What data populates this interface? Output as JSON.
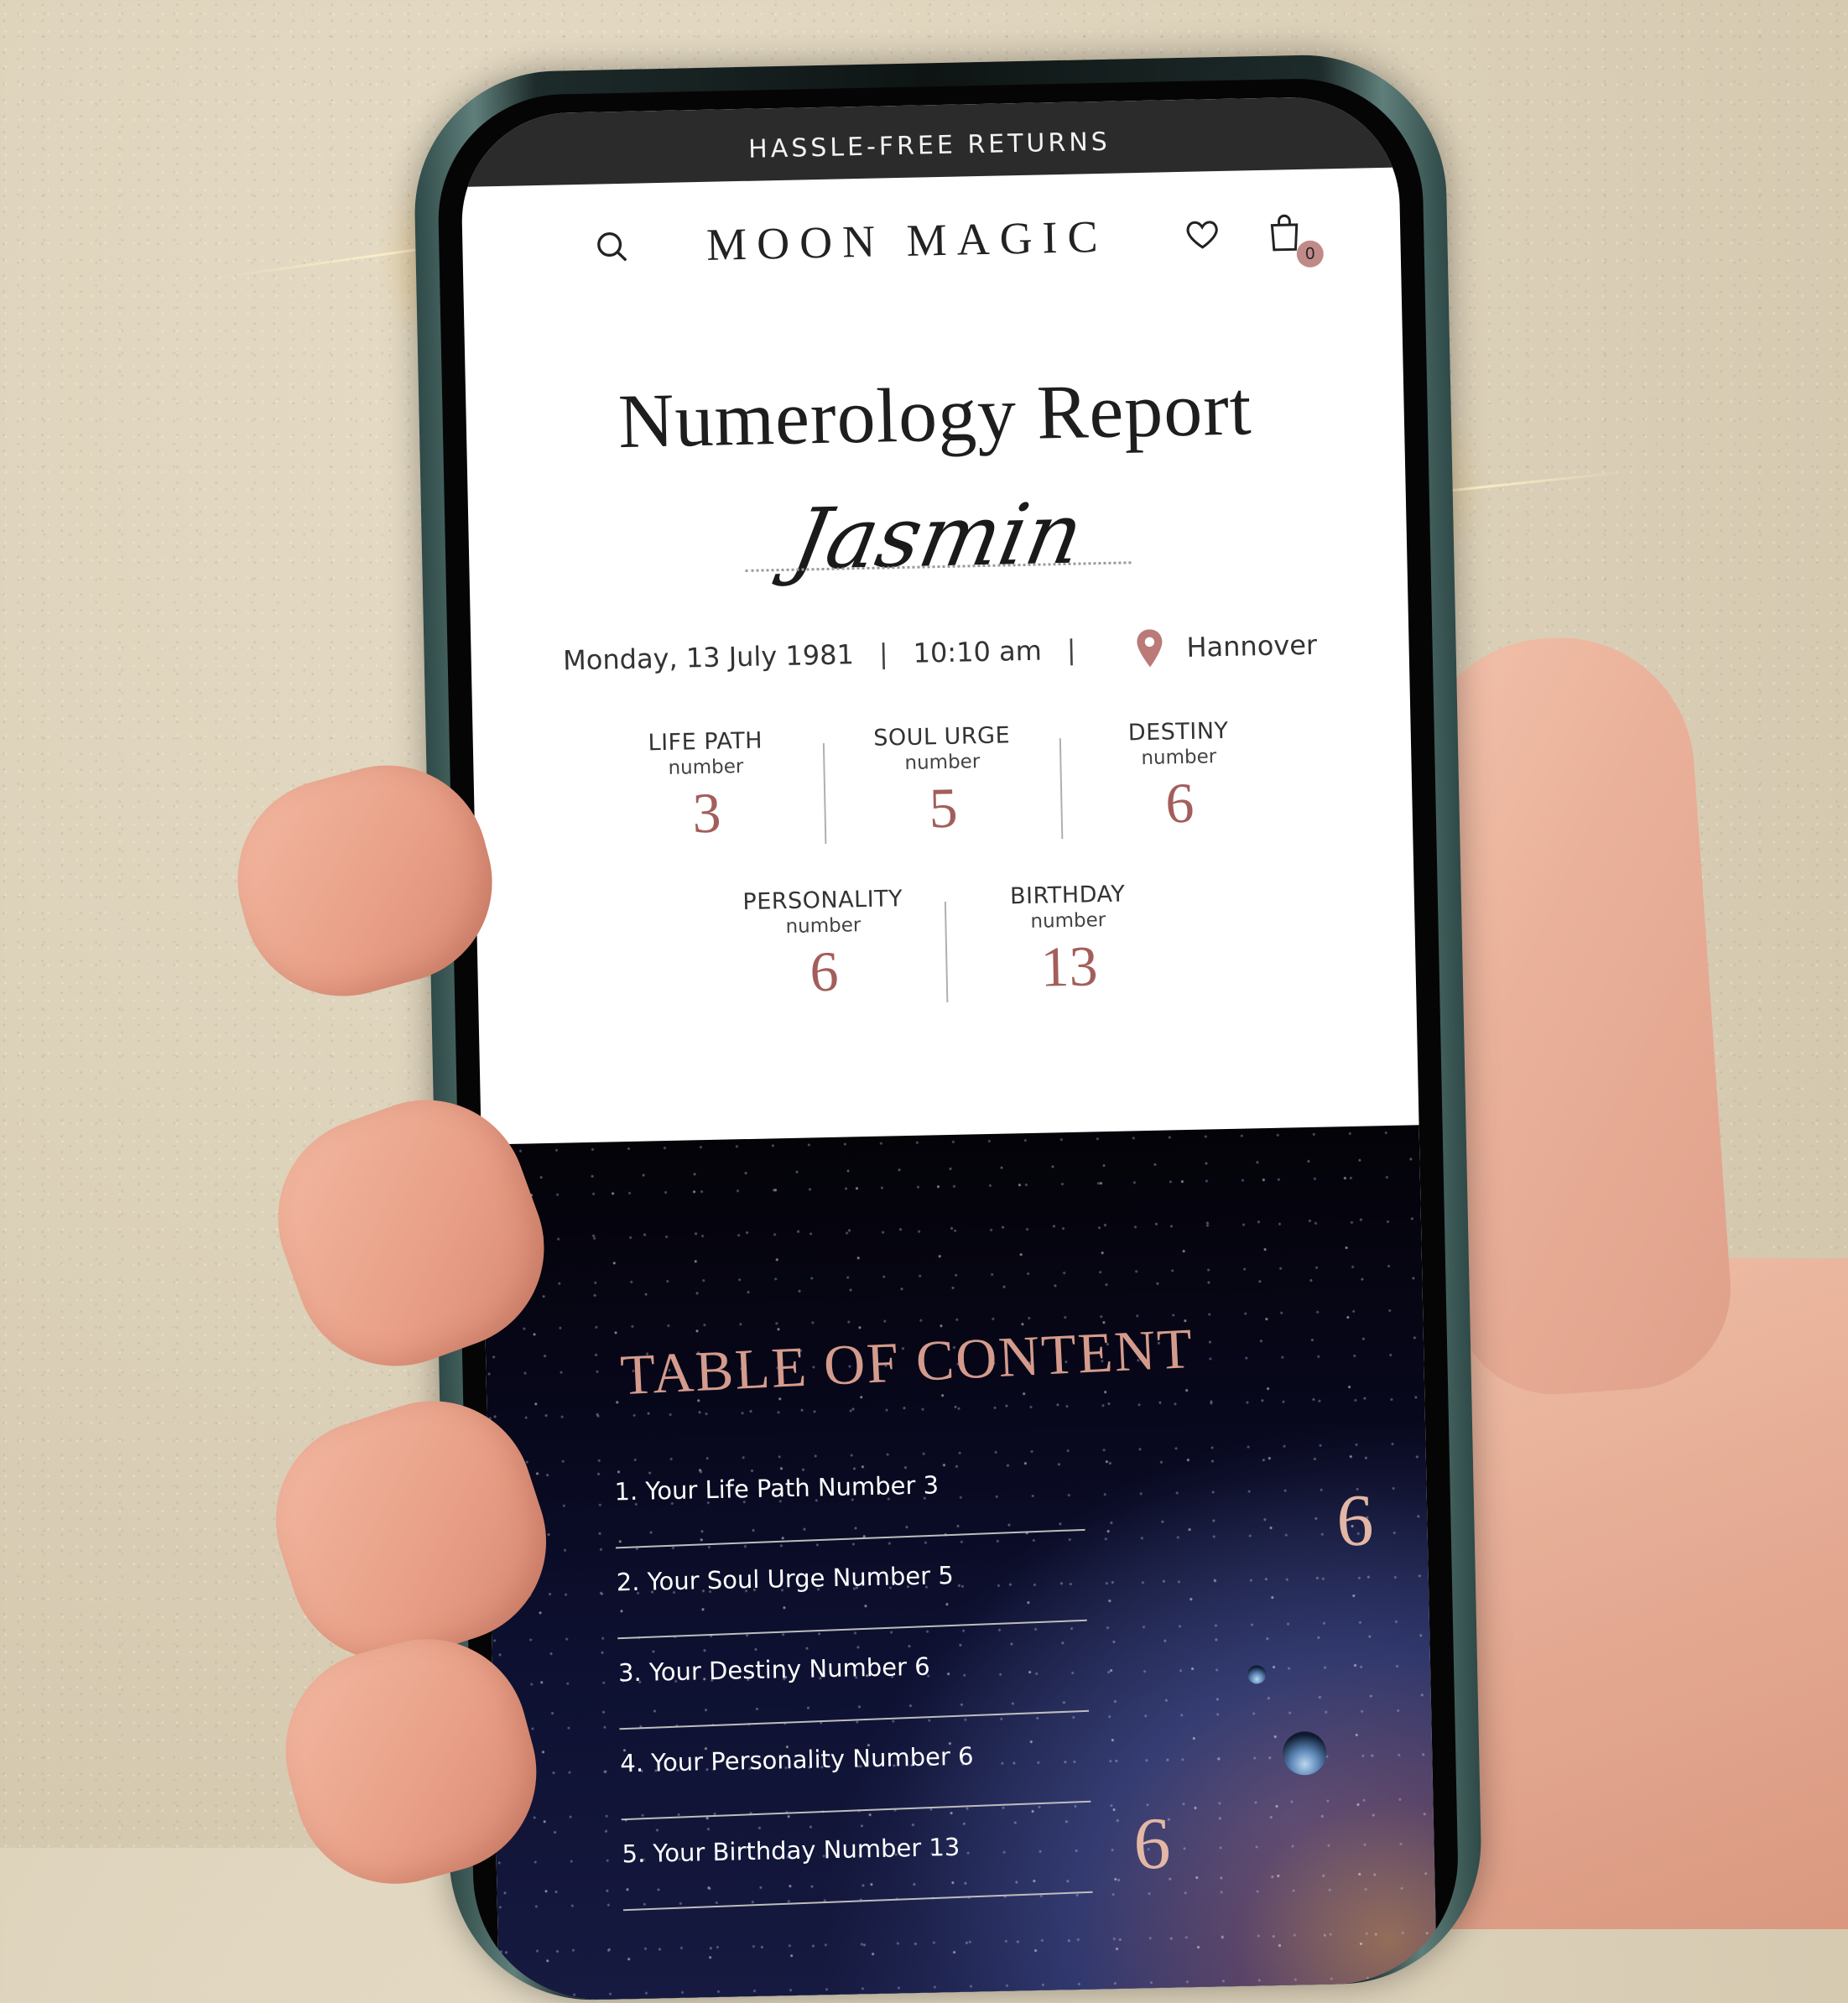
{
  "promo_bar": {
    "text": "HASSLE-FREE RETURNS"
  },
  "nav": {
    "brand": "MOON MAGIC",
    "search_icon": "search-icon",
    "wishlist_icon": "heart-icon",
    "cart_icon": "shopping-bag-icon",
    "cart_count": "0"
  },
  "report": {
    "title": "Numerology Report",
    "client_name": "Jasmin",
    "date": "Monday, 13 July 1981",
    "time": "10:10 am",
    "separator": "|",
    "location_icon": "map-pin-icon",
    "location": "Hannover"
  },
  "numbers": [
    {
      "label": "LIFE PATH",
      "sub": "number",
      "value": "3"
    },
    {
      "label": "SOUL URGE",
      "sub": "number",
      "value": "5"
    },
    {
      "label": "DESTINY",
      "sub": "number",
      "value": "6"
    },
    {
      "label": "PERSONALITY",
      "sub": "number",
      "value": "6"
    },
    {
      "label": "BIRTHDAY",
      "sub": "number",
      "value": "13"
    }
  ],
  "toc": {
    "title": "TABLE OF CONTENT",
    "items": [
      "1. Your Life Path Number 3",
      "2. Your Soul Urge Number 5",
      "3. Your Destiny Number 6",
      "4. Your Personality Number 6",
      "5. Your Birthday Number 13"
    ],
    "decorative_numbers": [
      "6",
      "6"
    ]
  },
  "colors": {
    "accent": "#a35e5c",
    "badge": "#c08a88",
    "toc_title": "#d49b8c",
    "promo_bg": "#2b2b2b"
  }
}
